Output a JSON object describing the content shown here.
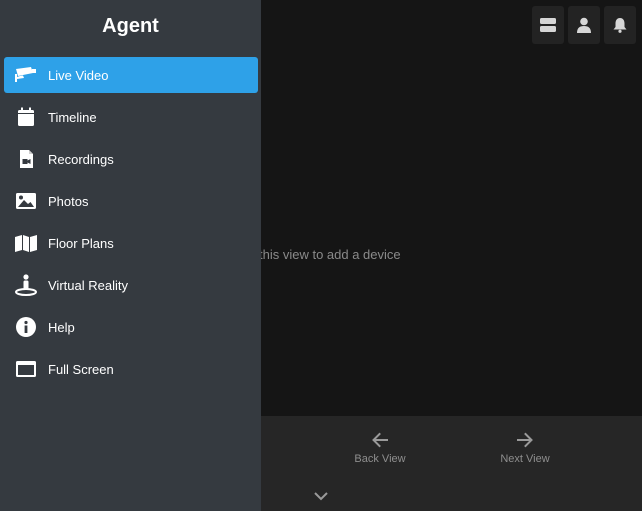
{
  "sidebar": {
    "title": "Agent",
    "items": [
      {
        "label": "Live Video",
        "icon": "cctv-camera-icon",
        "active": true
      },
      {
        "label": "Timeline",
        "icon": "calendar-icon",
        "active": false
      },
      {
        "label": "Recordings",
        "icon": "video-file-icon",
        "active": false
      },
      {
        "label": "Photos",
        "icon": "image-icon",
        "active": false
      },
      {
        "label": "Floor Plans",
        "icon": "map-icon",
        "active": false
      },
      {
        "label": "Virtual Reality",
        "icon": "vr-person-icon",
        "active": false
      },
      {
        "label": "Help",
        "icon": "info-icon",
        "active": false
      },
      {
        "label": "Full Screen",
        "icon": "window-icon",
        "active": false
      }
    ]
  },
  "main": {
    "hint_text": "this view to add a device"
  },
  "header": {
    "icons": [
      "layout-icon",
      "user-icon",
      "bell-icon"
    ]
  },
  "bottom_bar": {
    "back_label": "Back View",
    "next_label": "Next View"
  },
  "colors": {
    "accent": "#2ea1e8",
    "sidebar_bg": "#353a40",
    "main_bg": "#151515",
    "toolbar_bg": "#262626"
  }
}
